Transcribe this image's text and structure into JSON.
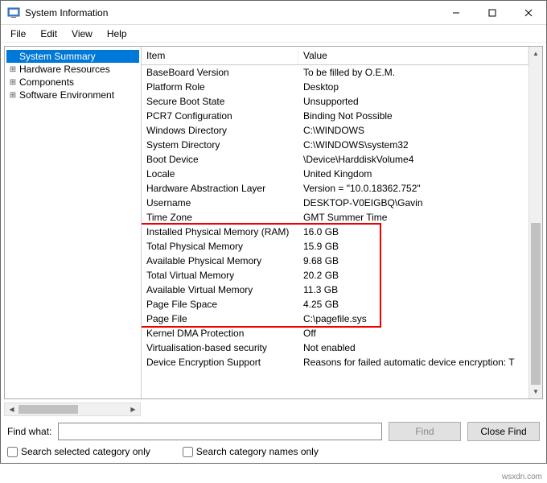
{
  "window": {
    "title": "System Information"
  },
  "menubar": [
    "File",
    "Edit",
    "View",
    "Help"
  ],
  "tree": {
    "items": [
      {
        "label": "System Summary",
        "expander": "",
        "selected": true
      },
      {
        "label": "Hardware Resources",
        "expander": "⊞",
        "selected": false
      },
      {
        "label": "Components",
        "expander": "⊞",
        "selected": false
      },
      {
        "label": "Software Environment",
        "expander": "⊞",
        "selected": false
      }
    ]
  },
  "list": {
    "columns": {
      "item": "Item",
      "value": "Value"
    },
    "rows": [
      {
        "item": "BaseBoard Version",
        "value": "To be filled by O.E.M."
      },
      {
        "item": "Platform Role",
        "value": "Desktop"
      },
      {
        "item": "Secure Boot State",
        "value": "Unsupported"
      },
      {
        "item": "PCR7 Configuration",
        "value": "Binding Not Possible"
      },
      {
        "item": "Windows Directory",
        "value": "C:\\WINDOWS"
      },
      {
        "item": "System Directory",
        "value": "C:\\WINDOWS\\system32"
      },
      {
        "item": "Boot Device",
        "value": "\\Device\\HarddiskVolume4"
      },
      {
        "item": "Locale",
        "value": "United Kingdom"
      },
      {
        "item": "Hardware Abstraction Layer",
        "value": "Version = \"10.0.18362.752\""
      },
      {
        "item": "Username",
        "value": "DESKTOP-V0EIGBQ\\Gavin"
      },
      {
        "item": "Time Zone",
        "value": "GMT Summer Time"
      },
      {
        "item": "Installed Physical Memory (RAM)",
        "value": "16.0 GB"
      },
      {
        "item": "Total Physical Memory",
        "value": "15.9 GB"
      },
      {
        "item": "Available Physical Memory",
        "value": "9.68 GB"
      },
      {
        "item": "Total Virtual Memory",
        "value": "20.2 GB"
      },
      {
        "item": "Available Virtual Memory",
        "value": "11.3 GB"
      },
      {
        "item": "Page File Space",
        "value": "4.25 GB"
      },
      {
        "item": "Page File",
        "value": "C:\\pagefile.sys"
      },
      {
        "item": "Kernel DMA Protection",
        "value": "Off"
      },
      {
        "item": "Virtualisation-based security",
        "value": "Not enabled"
      },
      {
        "item": "Device Encryption Support",
        "value": "Reasons for failed automatic device encryption: T"
      }
    ],
    "highlight_start": 11,
    "highlight_end": 17
  },
  "findbar": {
    "label": "Find what:",
    "value": "",
    "find_button": "Find",
    "close_button": "Close Find"
  },
  "checks": {
    "selected_only": "Search selected category only",
    "names_only": "Search category names only"
  },
  "watermark": "wsxdn.com"
}
